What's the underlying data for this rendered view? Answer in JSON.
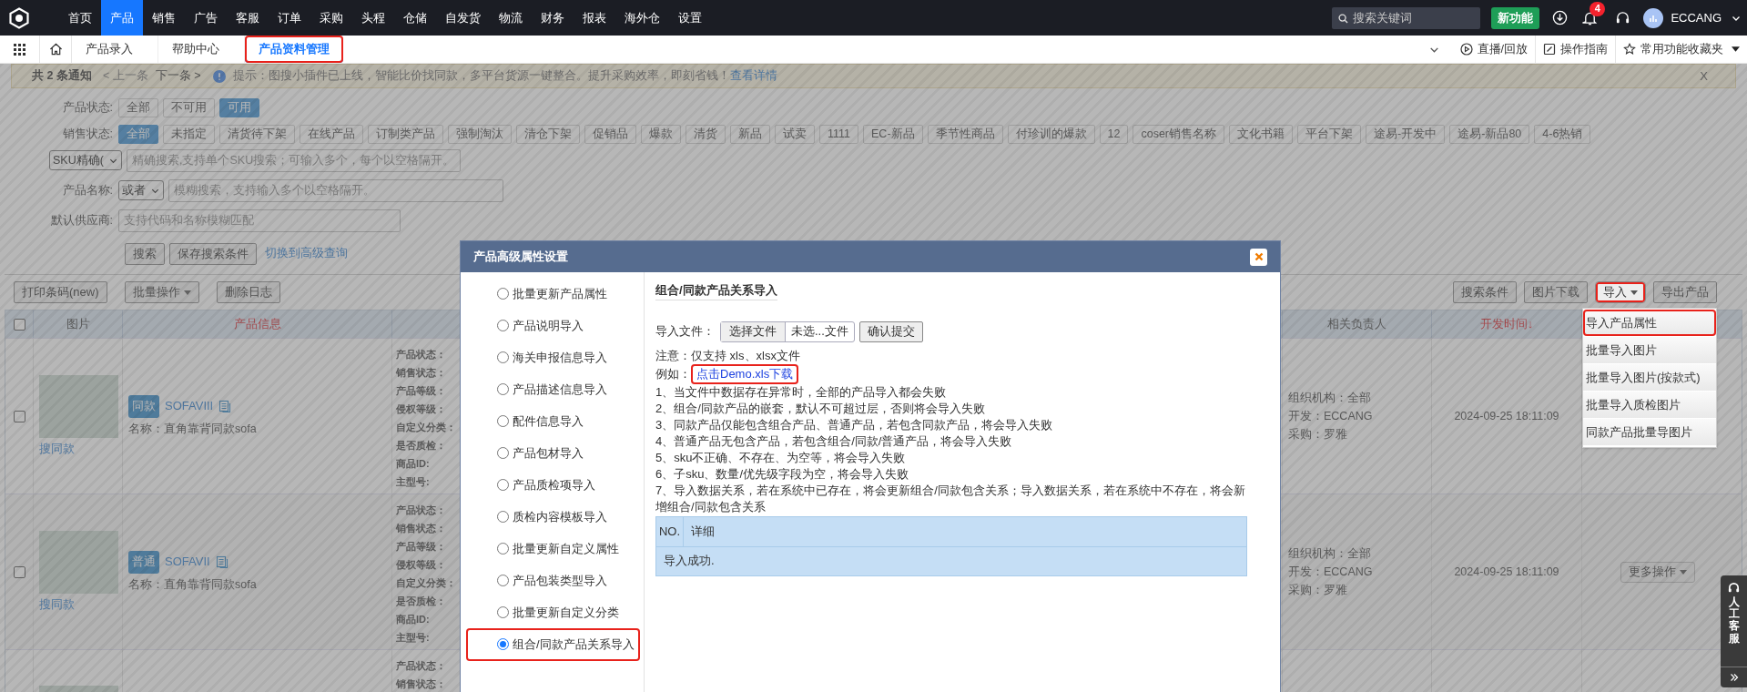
{
  "top_nav": {
    "menu": [
      {
        "label": "首页",
        "selected": false
      },
      {
        "label": "产品",
        "selected": true
      },
      {
        "label": "销售",
        "selected": false
      },
      {
        "label": "广告",
        "selected": false
      },
      {
        "label": "客服",
        "selected": false
      },
      {
        "label": "订单",
        "selected": false
      },
      {
        "label": "采购",
        "selected": false
      },
      {
        "label": "头程",
        "selected": false
      },
      {
        "label": "仓储",
        "selected": false
      },
      {
        "label": "自发货",
        "selected": false
      },
      {
        "label": "物流",
        "selected": false
      },
      {
        "label": "财务",
        "selected": false
      },
      {
        "label": "报表",
        "selected": false
      },
      {
        "label": "海外仓",
        "selected": false
      },
      {
        "label": "设置",
        "selected": false
      }
    ],
    "search": {
      "placeholder": "搜索关键词"
    },
    "new_feature_button": "新功能",
    "notification_count": "4",
    "user": "ECCANG"
  },
  "tab_bar": {
    "tabs": [
      {
        "label": "产品录入",
        "selected": false,
        "highlighted": false
      },
      {
        "label": "帮助中心",
        "selected": false,
        "highlighted": false
      },
      {
        "label": "产品资料管理",
        "selected": true,
        "highlighted": true
      }
    ],
    "right_links": [
      {
        "kind": "play",
        "label": "直播/回放"
      },
      {
        "kind": "guide",
        "label": "操作指南"
      },
      {
        "kind": "star",
        "label": "常用功能收藏夹"
      }
    ]
  },
  "notice": {
    "count_text": "共 2 条通知",
    "prev": {
      "label": "< 上一条",
      "disabled": true
    },
    "next": {
      "label": "下一条 >",
      "disabled": false
    },
    "message": "提示：图搜小插件已上线，智能比价找同款，多平台货源一键整合。提升采购效率，即刻省钱！",
    "link": "查看详情",
    "close": "X"
  },
  "filters": {
    "product_status": {
      "label": "产品状态:",
      "options": [
        {
          "label": "全部",
          "selected": false
        },
        {
          "label": "不可用",
          "selected": false
        },
        {
          "label": "可用",
          "selected": true
        }
      ]
    },
    "sales_status": {
      "label": "销售状态:",
      "options": [
        {
          "label": "全部",
          "selected": true
        },
        {
          "label": "未指定",
          "selected": false
        },
        {
          "label": "清货待下架",
          "selected": false
        },
        {
          "label": "在线产品",
          "selected": false
        },
        {
          "label": "订制类产品",
          "selected": false
        },
        {
          "label": "强制淘汰",
          "selected": false
        },
        {
          "label": "清仓下架",
          "selected": false
        },
        {
          "label": "促销品",
          "selected": false
        },
        {
          "label": "爆款",
          "selected": false
        },
        {
          "label": "清货",
          "selected": false
        },
        {
          "label": "新品",
          "selected": false
        },
        {
          "label": "试卖",
          "selected": false
        },
        {
          "label": "1111",
          "selected": false
        },
        {
          "label": "EC-新品",
          "selected": false
        },
        {
          "label": "季节性商品",
          "selected": false
        },
        {
          "label": "付珍训的爆款",
          "selected": false
        },
        {
          "label": "12",
          "selected": false
        },
        {
          "label": "coser销售名称",
          "selected": false
        },
        {
          "label": "文化书籍",
          "selected": false
        },
        {
          "label": "平台下架",
          "selected": false
        },
        {
          "label": "途易-开发中",
          "selected": false
        },
        {
          "label": "途易-新品80",
          "selected": false
        },
        {
          "label": "4-6热销",
          "selected": false
        }
      ]
    },
    "sku": {
      "mode": "SKU精确(",
      "placeholder": "精确搜索,支持单个SKU搜索；可输入多个，每个以空格隔开。"
    },
    "product_name": {
      "label": "产品名称:",
      "mode": "或者",
      "placeholder": "模糊搜索，支持输入多个以空格隔开。"
    },
    "supplier": {
      "label": "默认供应商:",
      "placeholder": "支持代码和名称模糊匹配"
    },
    "buttons": [
      "搜索",
      "保存搜索条件"
    ],
    "advanced_link": "切换到高级查询"
  },
  "toolbar": {
    "left": [
      {
        "label": "打印条码(new)",
        "dropdown": false,
        "highlighted": false
      },
      {
        "label": "批量操作",
        "dropdown": true,
        "highlighted": false
      },
      {
        "label": "删除日志",
        "dropdown": false,
        "highlighted": false
      }
    ],
    "right": [
      {
        "label": "搜索条件",
        "dropdown": false,
        "highlighted": false
      },
      {
        "label": "图片下载",
        "dropdown": false,
        "highlighted": false
      },
      {
        "label": "导入",
        "dropdown": true,
        "highlighted": true
      },
      {
        "label": "导出产品",
        "dropdown": false,
        "highlighted": false
      }
    ]
  },
  "import_menu": {
    "items": [
      {
        "label": "导入产品属性",
        "highlighted": true
      },
      {
        "label": "批量导入图片",
        "highlighted": false
      },
      {
        "label": "批量导入图片(按款式)",
        "highlighted": false
      },
      {
        "label": "批量导入质检图片",
        "highlighted": false
      },
      {
        "label": "同款产品批量导图片",
        "highlighted": false
      }
    ]
  },
  "table": {
    "select_all_checked": false,
    "columns": [
      {
        "label": "图片",
        "accent": false
      },
      {
        "label": "产品信息",
        "accent": true
      },
      {
        "label": "相关负责人",
        "accent": false
      },
      {
        "label": "开发时间↓",
        "accent": true
      }
    ],
    "rows": [
      {
        "checked": false,
        "search_link": "搜同款",
        "badge": "同款",
        "sku": "SOFAVIII",
        "name": "名称：直角靠背同款sofa",
        "attributes": [
          "产品状态：",
          "销售状态：",
          "产品等级：",
          "侵权等级：",
          "自定义分类：",
          "是否质检：",
          "商品ID:",
          "主型号:"
        ],
        "owners": [
          "组织机构：全部",
          "开发：ECCANG",
          "采购：罗雅"
        ],
        "dev_time": "2024-09-25 18:11:09"
      },
      {
        "checked": false,
        "search_link": "搜同款",
        "badge": "普通",
        "sku": "SOFAVII",
        "name": "名称：直角靠背同款sofa",
        "attributes": [
          "产品状态：",
          "销售状态：",
          "产品等级：",
          "侵权等级：",
          "自定义分类：",
          "是否质检：",
          "商品ID:",
          "主型号:"
        ],
        "owners": [
          "组织机构：全部",
          "开发：ECCANG",
          "采购：罗雅"
        ],
        "dev_time": "2024-09-25 18:11:09",
        "action": "更多操作"
      },
      {
        "attributes": [
          "产品状态：",
          "销售状态："
        ]
      }
    ]
  },
  "modal": {
    "title": "产品高级属性设置",
    "options": [
      {
        "label": "批量更新产品属性",
        "selected": false,
        "highlighted": false
      },
      {
        "label": "产品说明导入",
        "selected": false,
        "highlighted": false
      },
      {
        "label": "海关申报信息导入",
        "selected": false,
        "highlighted": false
      },
      {
        "label": "产品描述信息导入",
        "selected": false,
        "highlighted": false
      },
      {
        "label": "配件信息导入",
        "selected": false,
        "highlighted": false
      },
      {
        "label": "产品包材导入",
        "selected": false,
        "highlighted": false
      },
      {
        "label": "产品质检项导入",
        "selected": false,
        "highlighted": false
      },
      {
        "label": "质检内容模板导入",
        "selected": false,
        "highlighted": false
      },
      {
        "label": "批量更新自定义属性",
        "selected": false,
        "highlighted": false
      },
      {
        "label": "产品包装类型导入",
        "selected": false,
        "highlighted": false
      },
      {
        "label": "批量更新自定义分类",
        "selected": false,
        "highlighted": false
      },
      {
        "label": "组合/同款产品关系导入",
        "selected": true,
        "highlighted": true
      }
    ],
    "section_title": "组合/同款产品关系导入",
    "file_label": "导入文件：",
    "choose_file": "选择文件",
    "file_name": "未选...文件",
    "submit": "确认提交",
    "format_note": "注意：仅支持 xls、xlsx文件",
    "example_label": "例如：",
    "example_link": {
      "label": "点击Demo.xls下载",
      "highlighted": true
    },
    "rules": [
      "1、当文件中数据存在异常时，全部的产品导入都会失败",
      "2、组合/同款产品的嵌套，默认不可超过层，否则将会导入失败",
      "3、同款产品仅能包含组合产品、普通产品，若包含同款产品，将会导入失败",
      "4、普通产品无包含产品，若包含组合/同款/普通产品，将会导入失败",
      "5、sku不正确、不存在、为空等，将会导入失败",
      "6、子sku、数量/优先级字段为空，将会导入失败",
      "7、导入数据关系，若在系统中已存在，将会更新组合/同款包含关系；导入数据关系，若在系统中不存在，将会新增组合/同款包含关系"
    ],
    "result_columns": [
      "NO.",
      "详细"
    ],
    "result_rows": [
      {
        "message": "导入成功."
      }
    ]
  },
  "support_widget": {
    "label": "人工客服"
  }
}
